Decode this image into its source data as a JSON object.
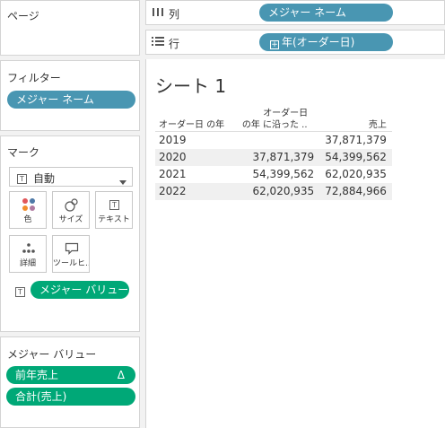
{
  "pages_panel": {
    "title": "ページ"
  },
  "columns_shelf": {
    "label": "列",
    "pill": "メジャー ネーム"
  },
  "rows_shelf": {
    "label": "行",
    "pill": "年(オーダー日)"
  },
  "filters": {
    "title": "フィルター",
    "pill": "メジャー ネーム"
  },
  "marks": {
    "title": "マーク",
    "type_value": "自動",
    "buttons": {
      "color": "色",
      "size": "サイズ",
      "text": "テキスト",
      "detail": "詳細",
      "tooltip": "ツールヒ..."
    },
    "text_pill": "メジャー バリュー"
  },
  "measure_values": {
    "title": "メジャー バリュー",
    "pills": [
      {
        "label": "前年売上",
        "badge": "Δ"
      },
      {
        "label": "合計(売上)"
      }
    ]
  },
  "sheet": {
    "title": "シート 1",
    "header": {
      "col1": "オーダー日 の年",
      "col2_line1": "オーダー日",
      "col2_line2": "の年 に沿った ..",
      "col3": "売上"
    },
    "rows": [
      {
        "year": "2019",
        "prev": "",
        "sales": "37,871,379"
      },
      {
        "year": "2020",
        "prev": "37,871,379",
        "sales": "54,399,562"
      },
      {
        "year": "2021",
        "prev": "54,399,562",
        "sales": "62,020,935"
      },
      {
        "year": "2022",
        "prev": "62,020,935",
        "sales": "72,884,966"
      }
    ]
  }
}
